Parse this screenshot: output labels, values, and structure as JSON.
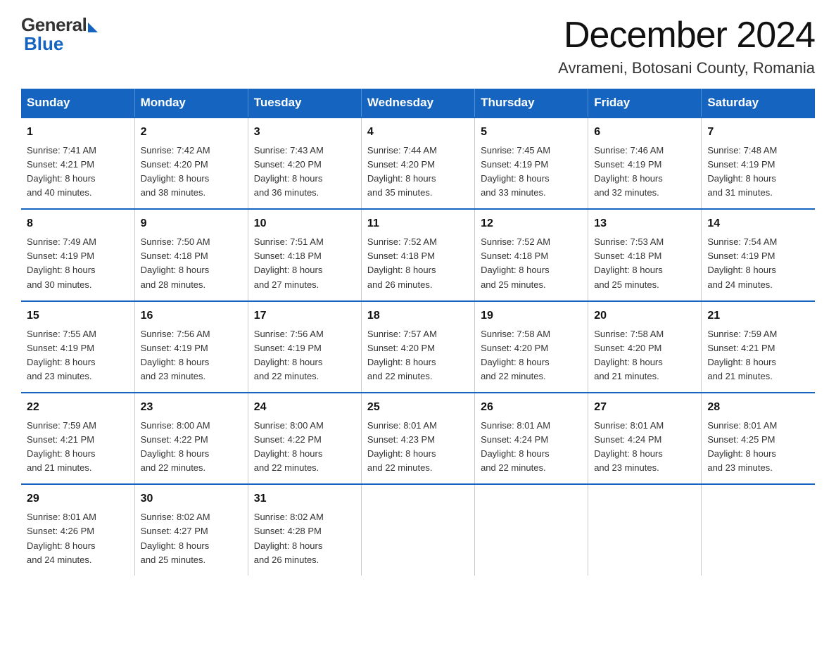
{
  "header": {
    "logo_general": "General",
    "logo_blue": "Blue",
    "month_title": "December 2024",
    "location": "Avrameni, Botosani County, Romania"
  },
  "days_of_week": [
    "Sunday",
    "Monday",
    "Tuesday",
    "Wednesday",
    "Thursday",
    "Friday",
    "Saturday"
  ],
  "weeks": [
    [
      {
        "day": "1",
        "sunrise": "7:41 AM",
        "sunset": "4:21 PM",
        "daylight": "8 hours and 40 minutes."
      },
      {
        "day": "2",
        "sunrise": "7:42 AM",
        "sunset": "4:20 PM",
        "daylight": "8 hours and 38 minutes."
      },
      {
        "day": "3",
        "sunrise": "7:43 AM",
        "sunset": "4:20 PM",
        "daylight": "8 hours and 36 minutes."
      },
      {
        "day": "4",
        "sunrise": "7:44 AM",
        "sunset": "4:20 PM",
        "daylight": "8 hours and 35 minutes."
      },
      {
        "day": "5",
        "sunrise": "7:45 AM",
        "sunset": "4:19 PM",
        "daylight": "8 hours and 33 minutes."
      },
      {
        "day": "6",
        "sunrise": "7:46 AM",
        "sunset": "4:19 PM",
        "daylight": "8 hours and 32 minutes."
      },
      {
        "day": "7",
        "sunrise": "7:48 AM",
        "sunset": "4:19 PM",
        "daylight": "8 hours and 31 minutes."
      }
    ],
    [
      {
        "day": "8",
        "sunrise": "7:49 AM",
        "sunset": "4:19 PM",
        "daylight": "8 hours and 30 minutes."
      },
      {
        "day": "9",
        "sunrise": "7:50 AM",
        "sunset": "4:18 PM",
        "daylight": "8 hours and 28 minutes."
      },
      {
        "day": "10",
        "sunrise": "7:51 AM",
        "sunset": "4:18 PM",
        "daylight": "8 hours and 27 minutes."
      },
      {
        "day": "11",
        "sunrise": "7:52 AM",
        "sunset": "4:18 PM",
        "daylight": "8 hours and 26 minutes."
      },
      {
        "day": "12",
        "sunrise": "7:52 AM",
        "sunset": "4:18 PM",
        "daylight": "8 hours and 25 minutes."
      },
      {
        "day": "13",
        "sunrise": "7:53 AM",
        "sunset": "4:18 PM",
        "daylight": "8 hours and 25 minutes."
      },
      {
        "day": "14",
        "sunrise": "7:54 AM",
        "sunset": "4:19 PM",
        "daylight": "8 hours and 24 minutes."
      }
    ],
    [
      {
        "day": "15",
        "sunrise": "7:55 AM",
        "sunset": "4:19 PM",
        "daylight": "8 hours and 23 minutes."
      },
      {
        "day": "16",
        "sunrise": "7:56 AM",
        "sunset": "4:19 PM",
        "daylight": "8 hours and 23 minutes."
      },
      {
        "day": "17",
        "sunrise": "7:56 AM",
        "sunset": "4:19 PM",
        "daylight": "8 hours and 22 minutes."
      },
      {
        "day": "18",
        "sunrise": "7:57 AM",
        "sunset": "4:20 PM",
        "daylight": "8 hours and 22 minutes."
      },
      {
        "day": "19",
        "sunrise": "7:58 AM",
        "sunset": "4:20 PM",
        "daylight": "8 hours and 22 minutes."
      },
      {
        "day": "20",
        "sunrise": "7:58 AM",
        "sunset": "4:20 PM",
        "daylight": "8 hours and 21 minutes."
      },
      {
        "day": "21",
        "sunrise": "7:59 AM",
        "sunset": "4:21 PM",
        "daylight": "8 hours and 21 minutes."
      }
    ],
    [
      {
        "day": "22",
        "sunrise": "7:59 AM",
        "sunset": "4:21 PM",
        "daylight": "8 hours and 21 minutes."
      },
      {
        "day": "23",
        "sunrise": "8:00 AM",
        "sunset": "4:22 PM",
        "daylight": "8 hours and 22 minutes."
      },
      {
        "day": "24",
        "sunrise": "8:00 AM",
        "sunset": "4:22 PM",
        "daylight": "8 hours and 22 minutes."
      },
      {
        "day": "25",
        "sunrise": "8:01 AM",
        "sunset": "4:23 PM",
        "daylight": "8 hours and 22 minutes."
      },
      {
        "day": "26",
        "sunrise": "8:01 AM",
        "sunset": "4:24 PM",
        "daylight": "8 hours and 22 minutes."
      },
      {
        "day": "27",
        "sunrise": "8:01 AM",
        "sunset": "4:24 PM",
        "daylight": "8 hours and 23 minutes."
      },
      {
        "day": "28",
        "sunrise": "8:01 AM",
        "sunset": "4:25 PM",
        "daylight": "8 hours and 23 minutes."
      }
    ],
    [
      {
        "day": "29",
        "sunrise": "8:01 AM",
        "sunset": "4:26 PM",
        "daylight": "8 hours and 24 minutes."
      },
      {
        "day": "30",
        "sunrise": "8:02 AM",
        "sunset": "4:27 PM",
        "daylight": "8 hours and 25 minutes."
      },
      {
        "day": "31",
        "sunrise": "8:02 AM",
        "sunset": "4:28 PM",
        "daylight": "8 hours and 26 minutes."
      },
      null,
      null,
      null,
      null
    ]
  ],
  "labels": {
    "sunrise": "Sunrise:",
    "sunset": "Sunset:",
    "daylight": "Daylight:"
  }
}
